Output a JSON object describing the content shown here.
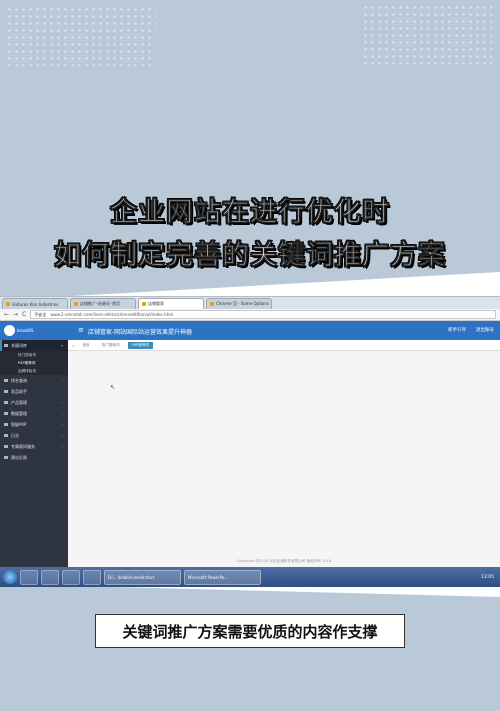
{
  "headline": {
    "line1": "企业网站在进行优化时",
    "line2": "如何制定完善的关键词推广方案"
  },
  "browser": {
    "tabs": [
      {
        "label": "Vultures Kiss Industries"
      },
      {
        "label": "店铺推广-关键词 ·首页"
      },
      {
        "label": "店铺管家"
      },
      {
        "label": "Chrome 页 · Some Options"
      }
    ],
    "active_tab_index": 2,
    "nav": {
      "back": "←",
      "forward": "→",
      "reload": "C"
    },
    "address": {
      "security": "不安全",
      "url": "www.2-umnstoh.com/lives-allntsck/mnsedkfbsrvol/index.html"
    }
  },
  "app": {
    "user": "brookBS",
    "title": "店铺管家-网站国际站运营效果提升神器",
    "top_actions": [
      "新手引导",
      "退出账号"
    ],
    "sidebar": [
      {
        "label": "关键词库",
        "active": true,
        "subs": [
          "热门搜索词",
          "P4P推荐词",
          "品牌排除词"
        ],
        "active_sub": 1
      },
      {
        "label": "排名查询"
      },
      {
        "label": "发品助手"
      },
      {
        "label": "产品管理"
      },
      {
        "label": "数据管理"
      },
      {
        "label": "智能P4P"
      },
      {
        "label": "日志"
      },
      {
        "label": "专属顾问服务"
      },
      {
        "label": "建议反馈"
      }
    ],
    "content_tabs": [
      "首页",
      "热门搜索词",
      "P4P推荐词"
    ],
    "selected_content_tab": 2,
    "footer": "Copyright @2018 北京佳铺软件有限公司 版权所有 2018"
  },
  "taskbar": {
    "windows": [
      "D:\\...\\kdalkfunecllrxfact",
      "Microsoft PowerPo..."
    ],
    "clock": "13:05"
  },
  "caption": "关键词推广方案需要优质的内容作支撑"
}
